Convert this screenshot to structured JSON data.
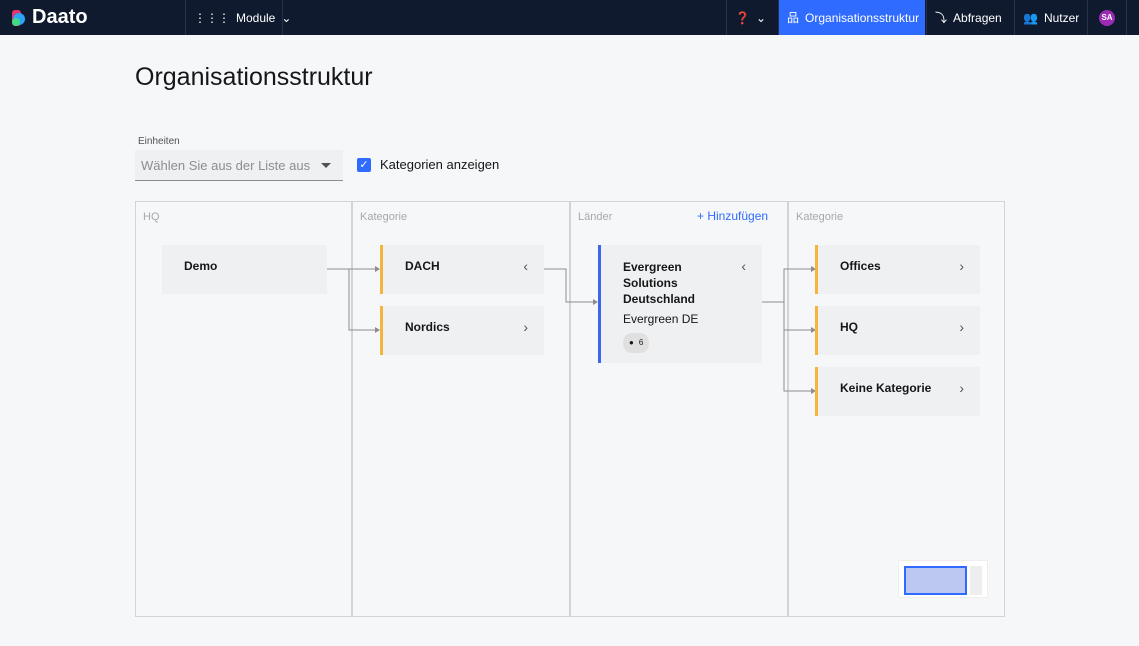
{
  "nav": {
    "brand": "Daato",
    "module": "Module",
    "items": [
      "Organisationsstruktur",
      "Abfragen",
      "Nutzer"
    ],
    "avatar": "SA",
    "accent": "#2f6bff"
  },
  "page": {
    "title": "Organisationsstruktur",
    "unit_label": "Einheiten",
    "unit_placeholder": "Wählen Sie aus der Liste aus",
    "show_categories": "Kategorien anzeigen",
    "show_categories_checked": true
  },
  "columns": [
    {
      "header": "HQ"
    },
    {
      "header": "Kategorie"
    },
    {
      "header": "Länder",
      "add": "+ Hinzufügen"
    },
    {
      "header": "Kategorie"
    }
  ],
  "cards": {
    "demo": "Demo",
    "dach": "DACH",
    "nordics": "Nordics",
    "evergreen": {
      "name": "Evergreen Solutions Deutschland",
      "short": "Evergreen DE",
      "users": "6"
    },
    "offices": "Offices",
    "hq": "HQ",
    "none": "Keine Kategorie"
  }
}
